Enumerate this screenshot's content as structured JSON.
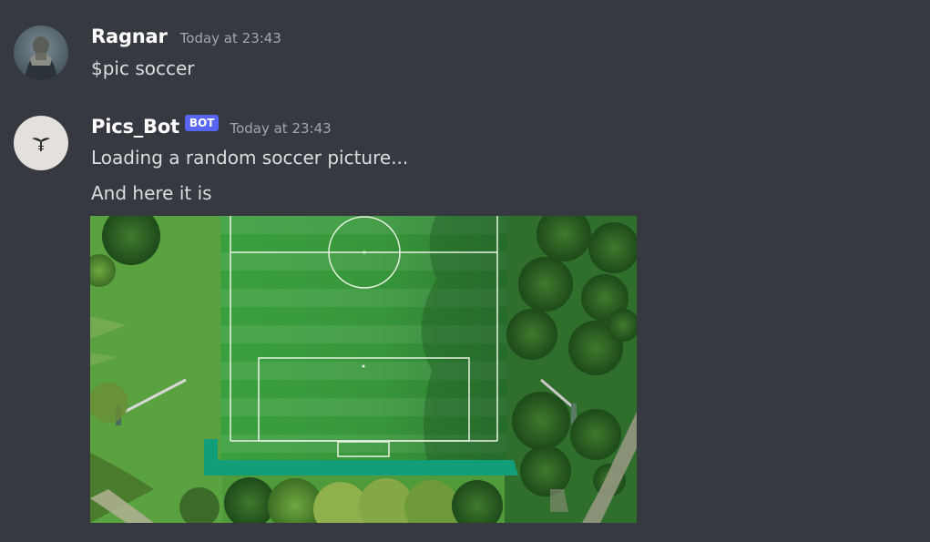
{
  "messages": [
    {
      "author": "Ragnar",
      "timestamp": "Today at 23:43",
      "lines": [
        "$pic soccer"
      ]
    },
    {
      "author": "Pics_Bot",
      "bot_tag": "BOT",
      "timestamp": "Today at 23:43",
      "lines": [
        "Loading a random soccer picture...",
        "And here it is"
      ]
    }
  ],
  "colors": {
    "background": "#36393f",
    "username": "#ffffff",
    "message_text": "#dcddde",
    "timestamp": "#a3a6aa",
    "bot_tag": "#5865f2"
  }
}
